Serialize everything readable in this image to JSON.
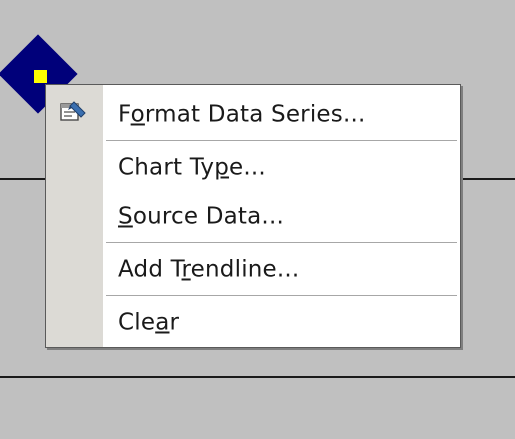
{
  "menu": {
    "items": [
      {
        "pre": "F",
        "acc": "o",
        "post": "rmat Data Series...",
        "icon": "format-data-series-icon"
      },
      {
        "pre": "Chart Ty",
        "acc": "p",
        "post": "e...",
        "icon": null
      },
      {
        "pre": "",
        "acc": "S",
        "post": "ource Data...",
        "icon": null
      },
      {
        "pre": "Add T",
        "acc": "r",
        "post": "endline...",
        "icon": null
      },
      {
        "pre": "Cle",
        "acc": "a",
        "post": "r",
        "icon": null
      }
    ]
  },
  "colors": {
    "plot_background": "#c0c0c0",
    "marker_fill": "#00007a",
    "marker_highlight": "#ffff00",
    "menu_background": "#ffffff",
    "menu_gutter": "#dcdad5"
  }
}
